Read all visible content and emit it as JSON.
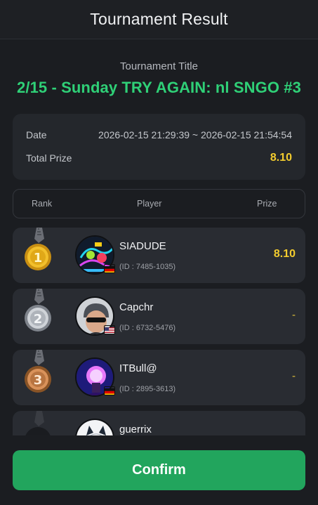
{
  "header": {
    "title": "Tournament Result"
  },
  "tournament": {
    "label": "Tournament Title",
    "title": "2/15 -  Sunday TRY AGAIN:  nl SNGO #3"
  },
  "info": {
    "date_label": "Date",
    "date_value": "2026-02-15 21:29:39 ~ 2026-02-15 21:54:54",
    "prize_label": "Total Prize",
    "prize_value": "8.10"
  },
  "columns": {
    "rank": "Rank",
    "player": "Player",
    "prize": "Prize"
  },
  "players": [
    {
      "rank": "1",
      "name": "SIADUDE",
      "id": "(ID : 7485-1035)",
      "prize": "8.10",
      "flag": "germany",
      "medal": "gold"
    },
    {
      "rank": "2",
      "name": "Capchr",
      "id": "(ID : 6732-5476)",
      "prize": "-",
      "flag": "usa",
      "medal": "silver"
    },
    {
      "rank": "3",
      "name": "ITBull@",
      "id": "(ID : 2895-3613)",
      "prize": "-",
      "flag": "germany",
      "medal": "bronze"
    },
    {
      "rank": "",
      "name": "guerrix",
      "id": "",
      "prize": "",
      "flag": "",
      "medal": "plain"
    }
  ],
  "footer": {
    "confirm_label": "Confirm"
  },
  "colors": {
    "accent_green": "#2fd077",
    "button_green": "#22a55d",
    "prize_gold": "#f3cc2e"
  }
}
